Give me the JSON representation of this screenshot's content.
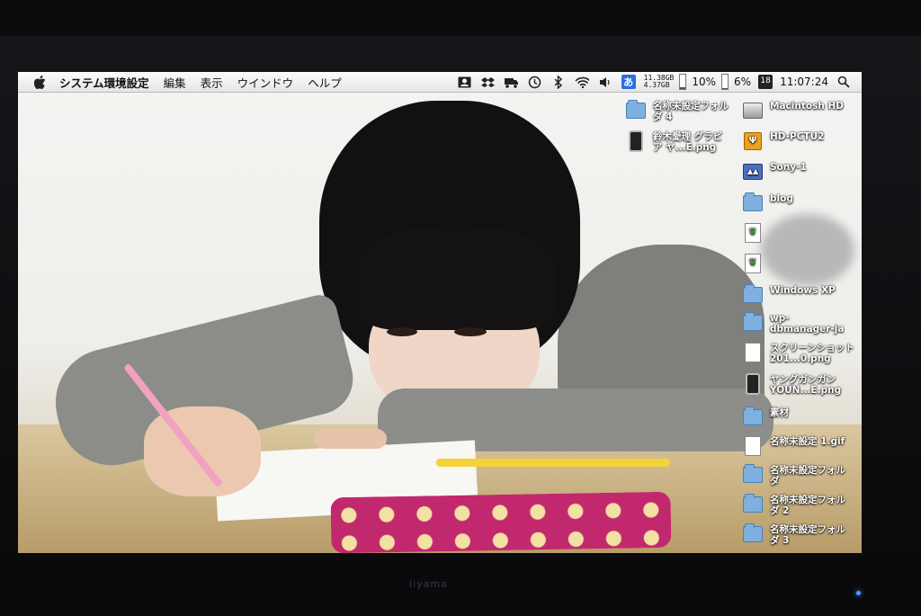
{
  "menubar": {
    "app_name": "システム環境設定",
    "menus": [
      "編集",
      "表示",
      "ウインドウ",
      "ヘルプ"
    ],
    "status": {
      "icons": [
        "contact-icon",
        "dropbox-icon",
        "truck-icon",
        "time-machine-icon",
        "bluetooth-icon",
        "wifi-icon",
        "volume-icon",
        "input-method-icon"
      ],
      "input_method": "あ",
      "mem_used": "11.38GB",
      "mem_free": "4.37GB",
      "cpu_percent": "10%",
      "cpu_fill": 0.1,
      "battery_percent": "6%",
      "battery_fill": 0.06,
      "calendar_day": "18",
      "clock": "11:07:24",
      "spotlight": "search-icon"
    }
  },
  "desktop": {
    "items": [
      {
        "label": "名称未設定フォル\nダ 4",
        "icon": "folder-icon"
      },
      {
        "label": "鈴木愛理 グラビ\nア ヤ...E.png",
        "icon": "phone-file-icon"
      },
      {
        "label": "Macintosh HD",
        "icon": "hard-drive-icon"
      },
      {
        "label": "HD-PCTU2",
        "icon": "usb-drive-icon"
      },
      {
        "label": "Sony-1",
        "icon": "network-drive-icon"
      },
      {
        "label": "blog",
        "icon": "folder-icon"
      },
      {
        "label": "",
        "icon": "leaf-file-icon"
      },
      {
        "label": "",
        "icon": "leaf-file-icon"
      },
      {
        "label": "Windows XP",
        "icon": "folder-icon"
      },
      {
        "label": "wp-\ndbmanager-ja",
        "icon": "folder-icon"
      },
      {
        "label": "スクリーンショット\n201...0.png",
        "icon": "image-file-icon"
      },
      {
        "label": "ヤングガンガン\nYOUN...E.png",
        "icon": "phone-file-icon"
      },
      {
        "label": "素材",
        "icon": "folder-icon"
      },
      {
        "label": "名称未設定 1.gif",
        "icon": "image-file-icon"
      },
      {
        "label": "名称未設定フォル\nダ",
        "icon": "folder-icon"
      },
      {
        "label": "名称未設定フォル\nダ 2",
        "icon": "folder-icon"
      },
      {
        "label": "名称未設定フォル\nダ 3",
        "icon": "folder-icon"
      }
    ]
  }
}
